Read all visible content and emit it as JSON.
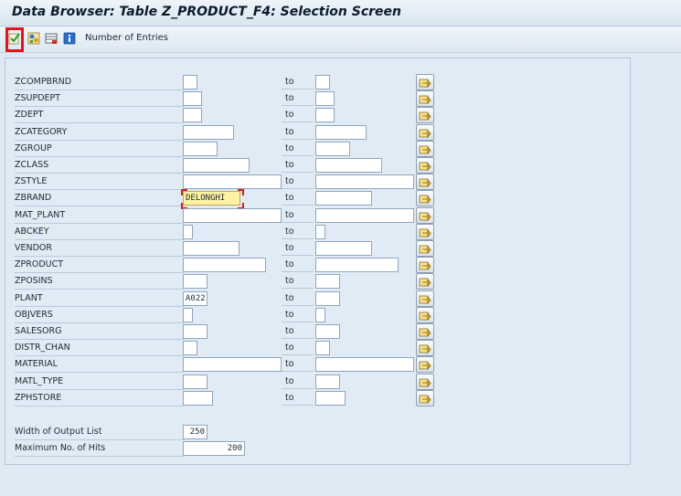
{
  "window": {
    "title": "Data Browser: Table Z_PRODUCT_F4: Selection Screen"
  },
  "toolbar": {
    "number_of_entries_label": "Number of Entries",
    "icons": [
      "execute-icon",
      "field-selection-icon",
      "selection-options-icon",
      "info-icon"
    ]
  },
  "selection": {
    "to_label": "to",
    "rows": [
      {
        "field": "ZCOMPBRND",
        "from_value": "",
        "to_value": ""
      },
      {
        "field": "ZSUPDEPT",
        "from_value": "",
        "to_value": ""
      },
      {
        "field": "ZDEPT",
        "from_value": "",
        "to_value": ""
      },
      {
        "field": "ZCATEGORY",
        "from_value": "",
        "to_value": ""
      },
      {
        "field": "ZGROUP",
        "from_value": "",
        "to_value": ""
      },
      {
        "field": "ZCLASS",
        "from_value": "",
        "to_value": ""
      },
      {
        "field": "ZSTYLE",
        "from_value": "",
        "to_value": ""
      },
      {
        "field": "ZBRAND",
        "from_value": "DELONGHI",
        "to_value": ""
      },
      {
        "field": "MAT_PLANT",
        "from_value": "",
        "to_value": ""
      },
      {
        "field": "ABCKEY",
        "from_value": "",
        "to_value": ""
      },
      {
        "field": "VENDOR",
        "from_value": "",
        "to_value": ""
      },
      {
        "field": "ZPRODUCT",
        "from_value": "",
        "to_value": ""
      },
      {
        "field": "ZPOSINS",
        "from_value": "",
        "to_value": ""
      },
      {
        "field": "PLANT",
        "from_value": "A022",
        "to_value": ""
      },
      {
        "field": "OBJVERS",
        "from_value": "",
        "to_value": ""
      },
      {
        "field": "SALESORG",
        "from_value": "",
        "to_value": ""
      },
      {
        "field": "DISTR_CHAN",
        "from_value": "",
        "to_value": ""
      },
      {
        "field": "MATERIAL",
        "from_value": "",
        "to_value": ""
      },
      {
        "field": "MATL_TYPE",
        "from_value": "",
        "to_value": ""
      },
      {
        "field": "ZPHSTORE",
        "from_value": "",
        "to_value": ""
      }
    ]
  },
  "output_settings": {
    "width_label": "Width of Output List",
    "width_value": "250",
    "max_hits_label": "Maximum No. of Hits",
    "max_hits_value": "200"
  },
  "colors": {
    "focus_highlight": "#fdf3a2",
    "execute_frame": "#e4141b"
  }
}
